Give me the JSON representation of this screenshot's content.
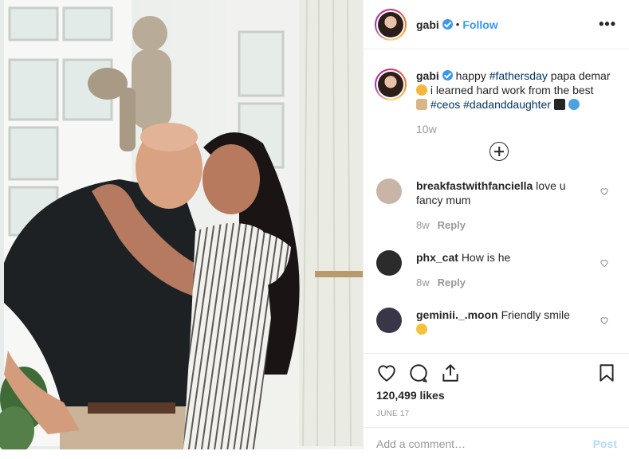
{
  "post": {
    "author": "gabi",
    "follow_label": "Follow",
    "dot": "•",
    "more_icon": "more-horizontal-icon"
  },
  "caption": {
    "user": "gabi",
    "text_1": "happy",
    "tag_1": "#fathersday",
    "text_2": "papa demar",
    "text_3": "i learned hard work from the best",
    "tag_2": "#ceos",
    "tag_3": "#dadanddaughter",
    "time": "10w"
  },
  "comments": [
    {
      "user": "breakfastwithfanciella",
      "text": "love u fancy mum",
      "time": "8w",
      "reply": "Reply",
      "avatar_color": "#c9b4a5"
    },
    {
      "user": "phx_cat",
      "text": "How is he",
      "time": "8w",
      "reply": "Reply",
      "avatar_color": "#2b2b2b"
    },
    {
      "user": "geminii._.moon",
      "text": "Friendly smile",
      "time": "",
      "reply": "",
      "avatar_color": "#3a3548"
    }
  ],
  "actions": {
    "likes": "120,499 likes",
    "date": "JUNE 17"
  },
  "add_comment": {
    "placeholder": "Add a comment…",
    "post_label": "Post"
  },
  "colors": {
    "accent": "#3897f0",
    "hashtag": "#003569",
    "muted": "#999999",
    "border": "#efefef"
  }
}
